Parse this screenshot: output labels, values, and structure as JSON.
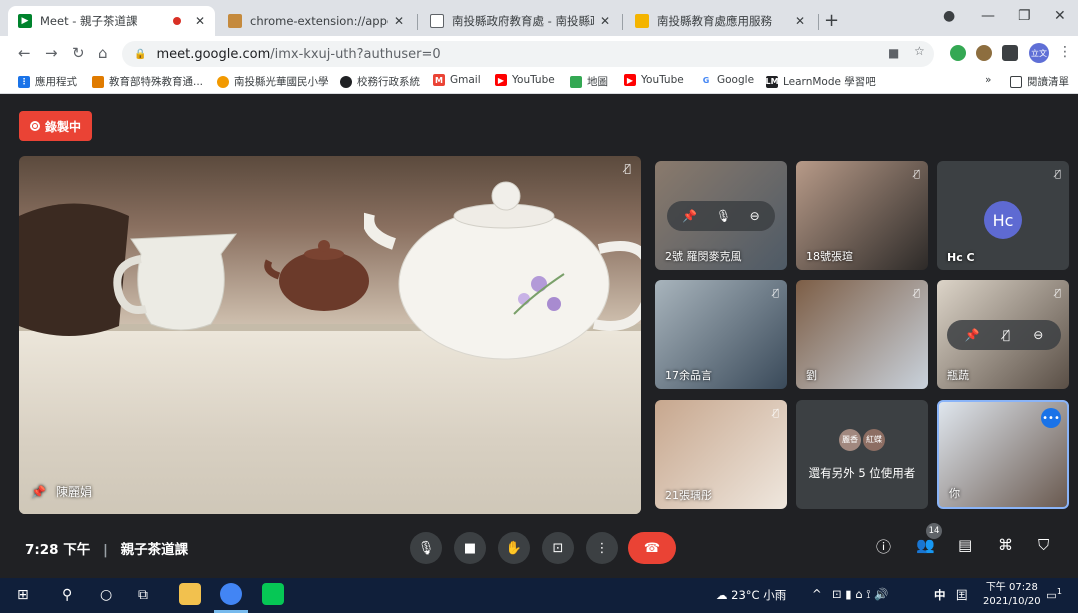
{
  "browser": {
    "tabs": [
      {
        "title": "Meet - 親子茶道課",
        "active": true
      },
      {
        "title": "chrome-extension://appcnhief",
        "active": false
      },
      {
        "title": "南投縣政府教育處 - 南投縣政府",
        "active": false
      },
      {
        "title": "南投縣教育處應用服務",
        "active": false
      }
    ],
    "url_host": "meet.google.com",
    "url_path": "/imx-kxuj-uth?authuser=0",
    "profile_label": "立文",
    "bookmarks": [
      "應用程式",
      "教育部特殊教育通...",
      "南投縣光華國民小學",
      "校務行政系統",
      "Gmail",
      "YouTube",
      "地圖",
      "YouTube",
      "Google",
      "LearnMode 學習吧"
    ],
    "bookmark_more": "»",
    "reading_list": "閱讀清單"
  },
  "meet": {
    "recording_label": "錄製中",
    "main_speaker": "陳麗娟",
    "tiles": [
      {
        "name": "2號 羅閔麥克風"
      },
      {
        "name": "18號張瑄"
      },
      {
        "name": "Hc C",
        "initials": "Hc"
      },
      {
        "name": "17余品言"
      },
      {
        "name": "劉"
      },
      {
        "name": "瓶蔬"
      },
      {
        "name": "21張瑀彤"
      },
      {
        "name": "你"
      }
    ],
    "others_avatars": [
      "麗香",
      "紅蝶"
    ],
    "others_text": "還有另外 5 位使用者",
    "meeting_time": "7:28 下午",
    "meeting_title": "親子茶道課",
    "participant_count": "14"
  },
  "taskbar": {
    "weather": "23°C 小雨",
    "ime": "中",
    "time": "下午 07:28",
    "date": "2021/10/20",
    "notification_count": "1"
  },
  "colors": {
    "meet_bg": "#202124",
    "hangup": "#ea4335",
    "recording": "#ea4335",
    "self_border": "#8ab4f8"
  }
}
